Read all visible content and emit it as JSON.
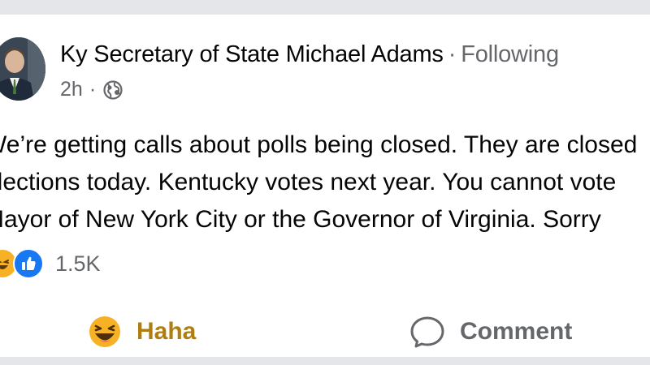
{
  "post": {
    "author": "Ky Secretary of State Michael Adams",
    "separator": "·",
    "follow_status": "Following",
    "time": "2h",
    "time_separator": "·",
    "audience_icon": "globe-icon",
    "text_lines": [
      "We’re getting calls about polls being closed. They are closed",
      "elections today. Kentucky votes next year. You cannot vote",
      "Mayor of New York City or the Governor of Virginia. Sorry"
    ],
    "reactions": {
      "icons": [
        "haha-reaction-icon",
        "like-reaction-icon"
      ],
      "count": "1.5K"
    }
  },
  "actions": {
    "react_label": "Haha",
    "comment_label": "Comment"
  },
  "colors": {
    "haha_active": "#b07d0f",
    "like_blue": "#1877f2",
    "haha_yellow": "#f7b125",
    "secondary_text": "#65676b"
  }
}
